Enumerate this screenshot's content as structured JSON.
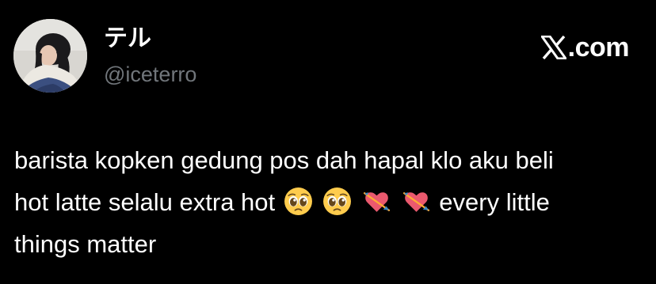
{
  "author": {
    "display_name": "テル",
    "handle": "@iceterro",
    "avatar_icon": "profile-photo-avatar"
  },
  "brand": {
    "icon": "x-logo-icon",
    "suffix": ".com"
  },
  "tweet": {
    "line1": "barista kopken gedung pos dah hapal klo aku beli",
    "line2_text": "hot latte selalu extra hot",
    "emojis": [
      "pleading-face-emoji",
      "pleading-face-emoji",
      "heart-with-arrow-emoji",
      "heart-with-arrow-emoji"
    ],
    "line2_tail": "every little",
    "line3": "things matter"
  },
  "colors": {
    "background": "#000000",
    "text_primary": "#ffffff",
    "text_secondary": "#71767b"
  }
}
